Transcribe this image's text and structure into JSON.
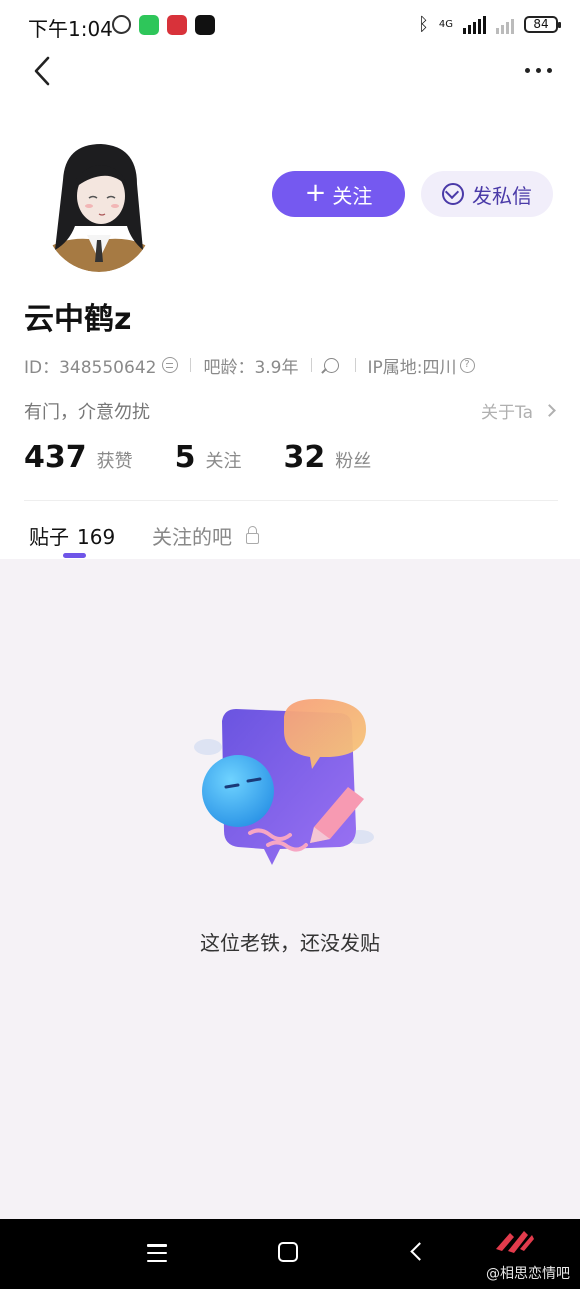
{
  "status_bar": {
    "time": "下午1:04",
    "network_label": "4G",
    "battery": "84"
  },
  "profile": {
    "username": "云中鹤z",
    "id_label": "ID：348550642",
    "age_label": "吧龄：3.9年",
    "ip_label": "IP属地:四川",
    "bio": "有门，介意勿扰",
    "about": "关于Ta"
  },
  "actions": {
    "follow": "关注",
    "message": "发私信"
  },
  "stats": [
    {
      "value": "437",
      "label": "获赞"
    },
    {
      "value": "5",
      "label": "关注"
    },
    {
      "value": "32",
      "label": "粉丝"
    }
  ],
  "tabs": {
    "posts_label": "贴子",
    "posts_count": "169",
    "followed_bars": "关注的吧"
  },
  "empty_state": {
    "message": "这位老铁，还没发贴"
  },
  "watermark": "@相思恋情吧",
  "colors": {
    "accent": "#7559f0",
    "content_bg": "#f5f2f6"
  }
}
